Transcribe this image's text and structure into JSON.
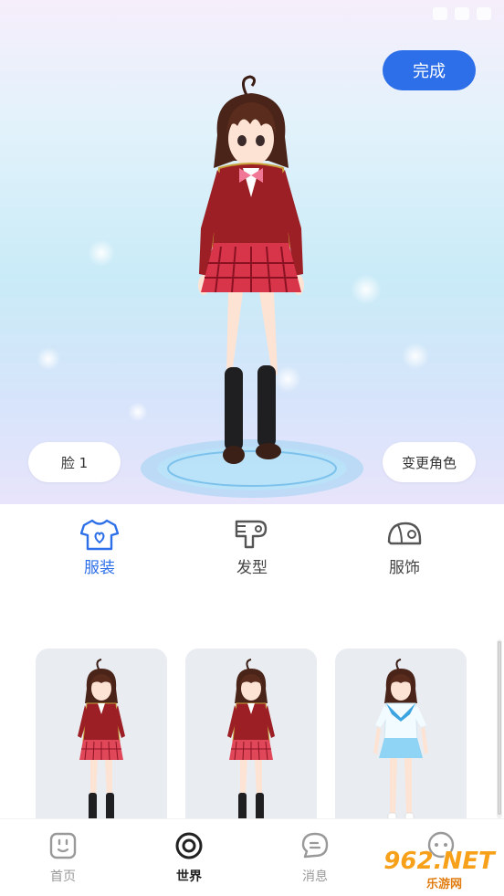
{
  "header": {
    "done_label": "完成"
  },
  "preview": {
    "face_label": "脸 1",
    "change_role_label": "变更角色"
  },
  "tabs": [
    {
      "label": "服装",
      "icon": "shirt-icon",
      "active": true
    },
    {
      "label": "发型",
      "icon": "hair-dryer-icon",
      "active": false
    },
    {
      "label": "服饰",
      "icon": "cap-icon",
      "active": false
    }
  ],
  "outfits": [
    {
      "name": "red-blazer-uniform-1",
      "top_color": "#9b1f24",
      "skirt_color": "#e0485a"
    },
    {
      "name": "red-blazer-uniform-2",
      "top_color": "#9b1f24",
      "skirt_color": "#e0485a"
    },
    {
      "name": "sailor-uniform",
      "top_color": "#f2fbff",
      "skirt_color": "#8fd4f4"
    }
  ],
  "bottom_nav": [
    {
      "label": "首页",
      "icon": "home-face-icon",
      "active": false
    },
    {
      "label": "世界",
      "icon": "world-ring-icon",
      "active": true
    },
    {
      "label": "消息",
      "icon": "message-bubble-icon",
      "active": false
    },
    {
      "label": "",
      "icon": "chat-dots-icon",
      "active": false
    }
  ],
  "watermark": {
    "logo": "962.NET",
    "sub": "乐游网"
  },
  "colors": {
    "accent": "#2d6fe8",
    "card_bg": "#e9ecf1",
    "nav_inactive": "#999999"
  }
}
